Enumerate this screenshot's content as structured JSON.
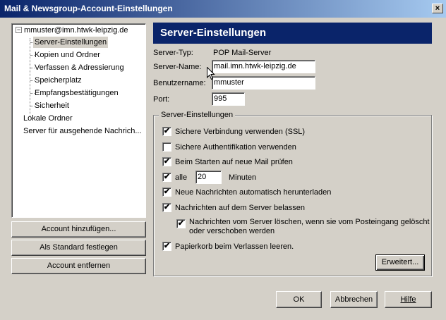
{
  "window": {
    "title": "Mail & Newsgroup-Account-Einstellungen",
    "close_symbol": "×"
  },
  "tree": {
    "root_label": "mmuster@imn.htwk-leipzig.de",
    "root_toggle": "−",
    "children": [
      {
        "label": "Server-Einstellungen",
        "selected": true
      },
      {
        "label": "Kopien und Ordner"
      },
      {
        "label": "Verfassen & Adressierung"
      },
      {
        "label": "Speicherplatz"
      },
      {
        "label": "Empfangsbestätigungen"
      },
      {
        "label": "Sicherheit"
      }
    ],
    "other": [
      {
        "label": "Lokale Ordner"
      },
      {
        "label": "Server für ausgehende Nachrich..."
      }
    ]
  },
  "left_buttons": {
    "add_account": "Account hinzufügen...",
    "set_default": "Als Standard festlegen",
    "remove_account": "Account entfernen"
  },
  "panel": {
    "title": "Server-Einstellungen",
    "server_type_label": "Server-Typ:",
    "server_type_value": "POP Mail-Server",
    "server_name_label": "Server-Name:",
    "server_name_value": "mail.imn.htwk-leipzig.de",
    "username_label": "Benutzername:",
    "username_value": "mmuster",
    "port_label": "Port:",
    "port_value": "995"
  },
  "group": {
    "title": "Server-Einstellungen",
    "ssl": {
      "label": "Sichere Verbindung verwenden (SSL)",
      "checked": true
    },
    "secure_auth": {
      "label": "Sichere Authentifikation verwenden",
      "checked": false
    },
    "check_on_start": {
      "label": "Beim Starten auf neue Mail prüfen",
      "checked": true
    },
    "interval": {
      "prefix": "alle",
      "value": "20",
      "suffix": "Minuten",
      "checked": true
    },
    "auto_download": {
      "label": "Neue Nachrichten automatisch herunterladen",
      "checked": true
    },
    "leave_on_server": {
      "label": "Nachrichten auf dem Server belassen",
      "checked": true
    },
    "delete_from_server": {
      "label_line1": "Nachrichten vom Server löschen, wenn sie vom Posteingang gelöscht",
      "label_line2": "oder verschoben werden",
      "checked": true
    },
    "empty_trash": {
      "label": "Papierkorb beim Verlassen leeren.",
      "checked": true
    },
    "advanced_button": "Erweitert..."
  },
  "footer": {
    "ok": "OK",
    "cancel": "Abbrechen",
    "help": "Hilfe"
  },
  "check_symbol": "✔"
}
